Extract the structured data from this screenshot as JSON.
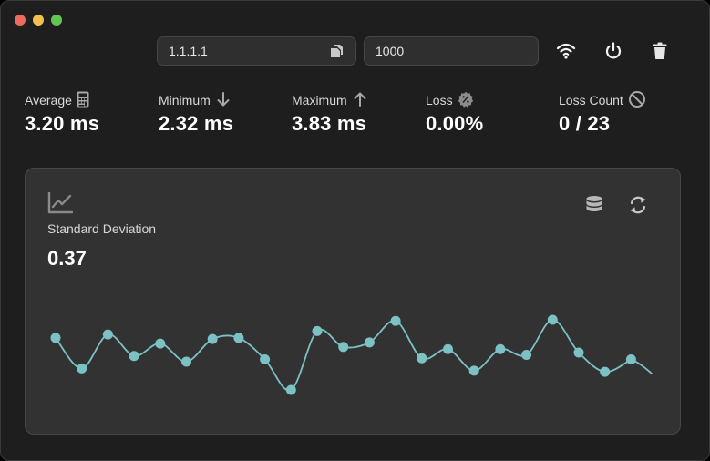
{
  "toolbar": {
    "host": "1.1.1.1",
    "interval": "1000"
  },
  "stats": [
    {
      "label": "Average",
      "value": "3.20 ms",
      "icon": "calculator-icon"
    },
    {
      "label": "Minimum",
      "value": "2.32 ms",
      "icon": "arrow-down-icon"
    },
    {
      "label": "Maximum",
      "value": "3.83 ms",
      "icon": "arrow-up-icon"
    },
    {
      "label": "Loss",
      "value": "0.00%",
      "icon": "percent-badge-icon"
    },
    {
      "label": "Loss Count",
      "value": "0 / 23",
      "icon": "prohibited-icon"
    }
  ],
  "card": {
    "label": "Standard Deviation",
    "value": "0.37"
  },
  "colors": {
    "accent": "#7cc2c4",
    "background": "#1e1e1e",
    "card": "#323233"
  },
  "chart_data": {
    "type": "line",
    "series": [
      {
        "values": [
          3.22,
          2.95,
          3.25,
          3.06,
          3.17,
          3.01,
          3.21,
          3.22,
          3.03,
          2.76,
          3.28,
          3.14,
          3.18,
          3.37,
          3.04,
          3.12,
          2.93,
          3.12,
          3.07,
          3.38,
          3.09,
          2.92,
          3.03
        ]
      }
    ],
    "grid": false,
    "legend": "none"
  }
}
